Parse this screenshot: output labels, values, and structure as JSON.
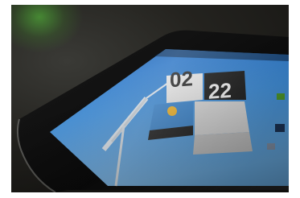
{
  "clock": {
    "hour": "02",
    "minute": "22"
  },
  "colors": {
    "sky_top": "#1f6fc4",
    "sky_bottom": "#5ea7e6",
    "bezel": "#0d0d0d",
    "desk": "#2a2925",
    "tile_light": "#e8e8e8",
    "tile_dark": "#1a1a1a",
    "weather_blue": "#3a86d0"
  },
  "icons": {
    "weather": "sun-icon",
    "wind_turbine": "wind-turbine-icon"
  }
}
